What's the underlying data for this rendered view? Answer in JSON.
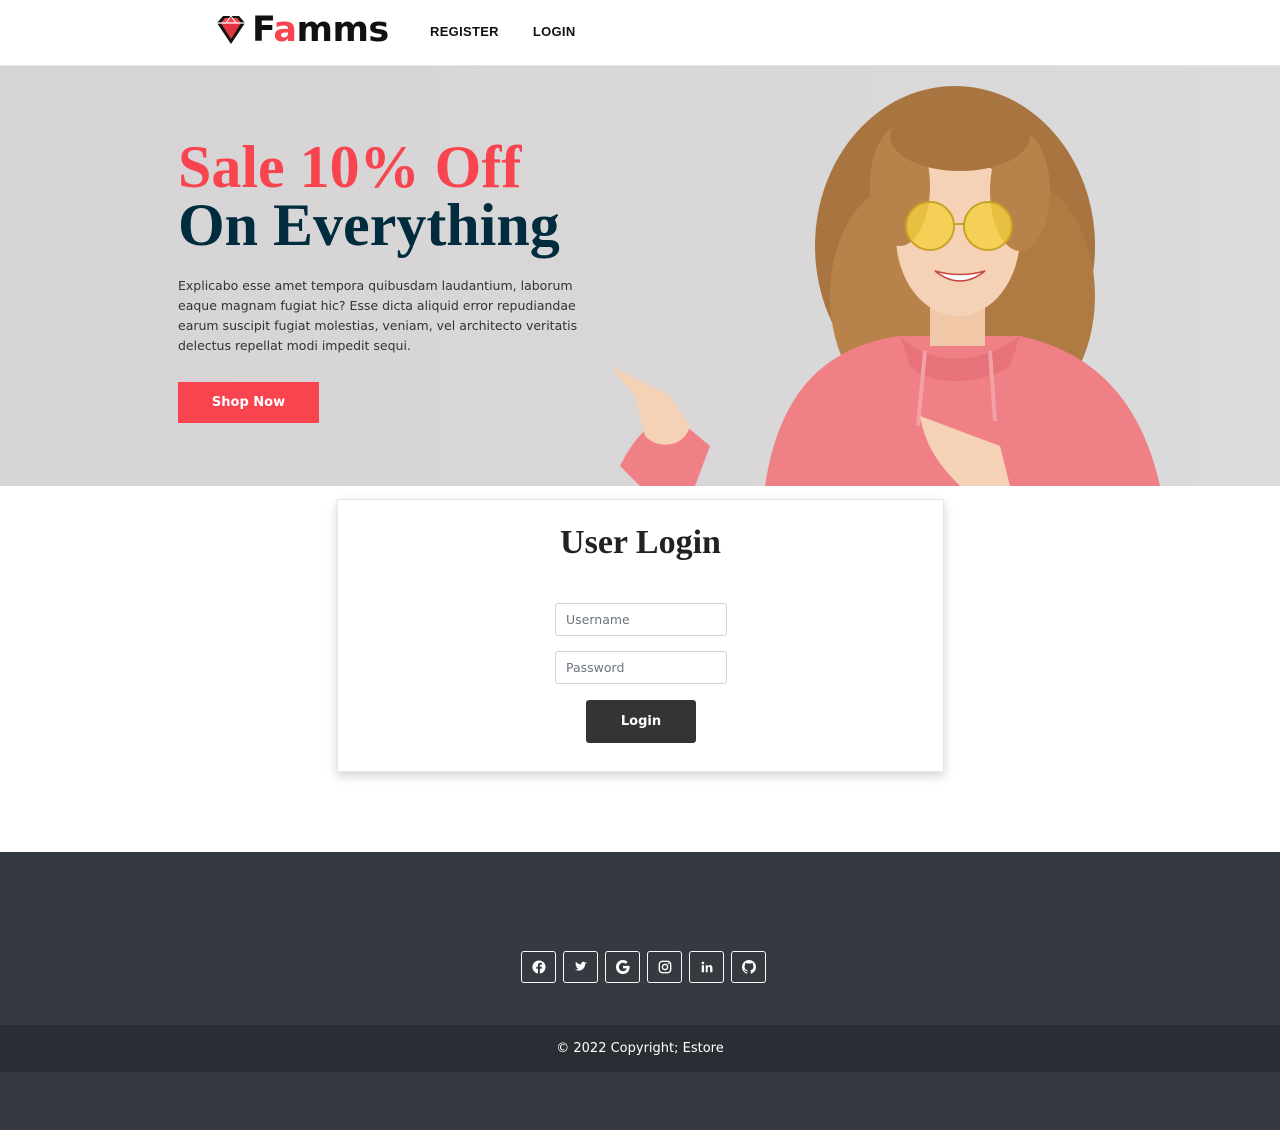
{
  "brand": {
    "name_prefix": "F",
    "name_accent": "a",
    "name_suffix": "mms",
    "accent_color": "#f7444e"
  },
  "nav": {
    "register_label": "REGISTER",
    "login_label": "LOGIN"
  },
  "hero": {
    "title_line1": "Sale 10% Off",
    "title_line2": "On Everything",
    "description": "Explicabo esse amet tempora quibusdam laudantium, laborum eaque magnam fugiat hic? Esse dicta aliquid error repudiandae earum suscipit fugiat molestias, veniam, vel architecto veritatis delectus repellat modi impedit sequi.",
    "shop_button": "Shop Now"
  },
  "login": {
    "title": "User Login",
    "username_placeholder": "Username",
    "password_placeholder": "Password",
    "submit_label": "Login"
  },
  "footer": {
    "social_icons": [
      "facebook-icon",
      "twitter-icon",
      "google-icon",
      "instagram-icon",
      "linkedin-icon",
      "github-icon"
    ],
    "copyright": "© 2022 Copyright; Estore"
  }
}
